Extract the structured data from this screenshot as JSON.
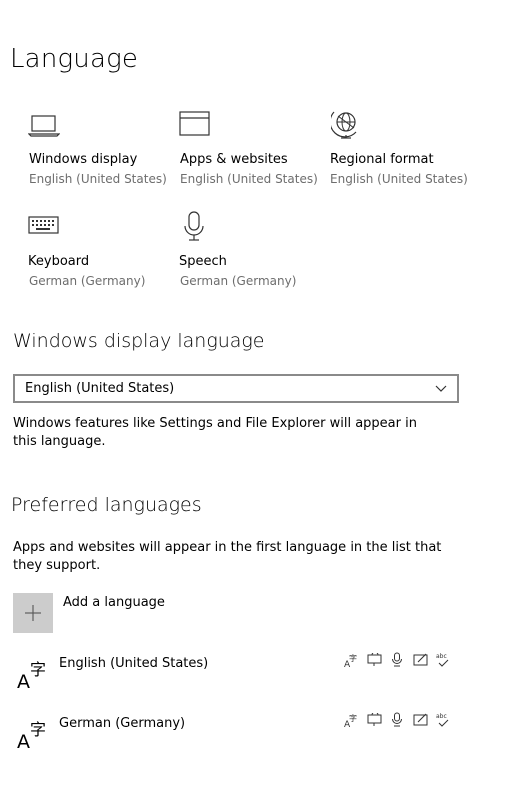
{
  "page": {
    "title": "Language"
  },
  "tiles": [
    {
      "icon": "laptop-icon",
      "title": "Windows display",
      "subtitle": "English (United States)"
    },
    {
      "icon": "browser-window-icon",
      "title": "Apps & websites",
      "subtitle": "English (United States)"
    },
    {
      "icon": "globe-icon",
      "title": "Regional format",
      "subtitle": "English (United States)"
    },
    {
      "icon": "keyboard-icon",
      "title": "Keyboard",
      "subtitle": "German (Germany)"
    },
    {
      "icon": "microphone-icon",
      "title": "Speech",
      "subtitle": "German (Germany)"
    }
  ],
  "display_language": {
    "title": "Windows display language",
    "selected": "English (United States)",
    "description": "Windows features like Settings and File Explorer will appear in this language."
  },
  "preferred": {
    "title": "Preferred languages",
    "description": "Apps and websites will appear in the first language in the list that they support.",
    "add_label": "Add a language",
    "languages": [
      {
        "name": "English (United States)"
      },
      {
        "name": "German (Germany)"
      }
    ],
    "feature_icons": [
      "language-pack-icon",
      "text-to-speech-icon",
      "speech-recognition-icon",
      "handwriting-icon",
      "spellcheck-icon"
    ]
  }
}
